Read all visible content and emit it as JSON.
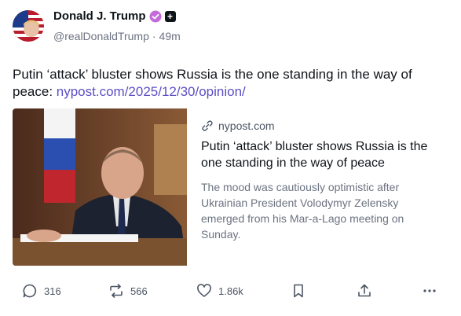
{
  "author": {
    "display_name": "Donald J. Trump",
    "handle": "@realDonaldTrump",
    "separator": "·",
    "time_ago": "49m",
    "plus_badge": "+"
  },
  "post": {
    "text": "Putin ‘attack’ bluster shows Russia is the one standing in the way of peace: ",
    "link_text": "nypost.com/2025/12/30/opinion/"
  },
  "card": {
    "domain": "nypost.com",
    "title": "Putin ‘attack’ bluster shows Russia is the one standing in the way of peace",
    "description": "The mood was cautiously optimistic after Ukrainian President Volodymyr Zelensky emerged from his Mar-a-Lago meeting on Sunday."
  },
  "actions": {
    "reply_count": "316",
    "repost_count": "566",
    "like_count": "1.86k"
  },
  "colors": {
    "link": "#5b4fc4",
    "verified": "#c46bd9",
    "muted": "#6b7280"
  },
  "icons": {
    "reply": "speech-bubble-icon",
    "repost": "repost-arrows-icon",
    "like": "heart-icon",
    "bookmark": "bookmark-icon",
    "share": "share-upload-icon",
    "more": "ellipsis-icon"
  }
}
